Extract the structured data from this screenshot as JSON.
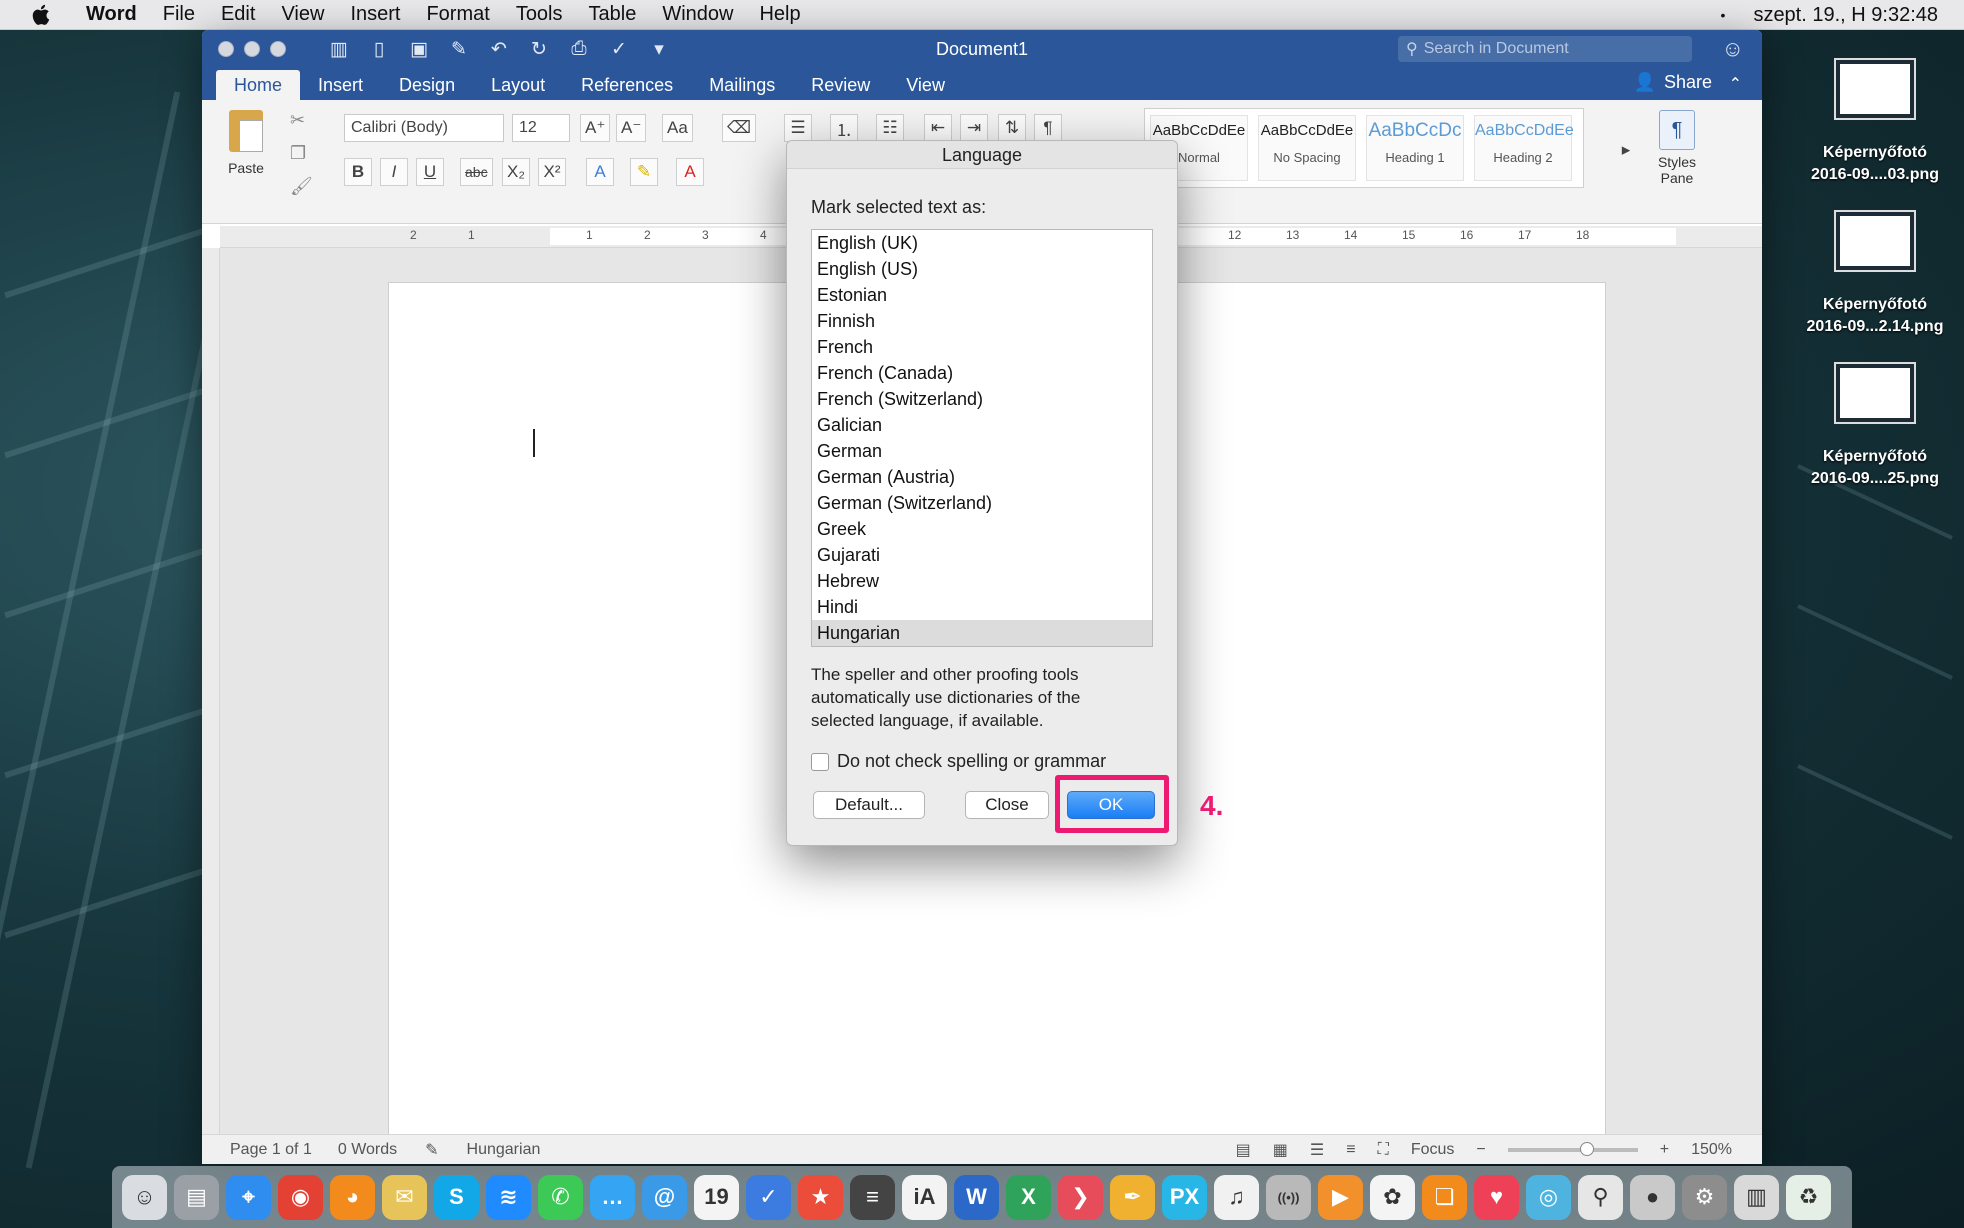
{
  "menubar": {
    "app_name": "Word",
    "items": [
      "File",
      "Edit",
      "View",
      "Insert",
      "Format",
      "Tools",
      "Table",
      "Window",
      "Help"
    ],
    "status_dot": "•",
    "clock": "szept. 19., H  9:32:48"
  },
  "window": {
    "title": "Document1",
    "search_placeholder": "Search in Document",
    "tabs": [
      "Home",
      "Insert",
      "Design",
      "Layout",
      "References",
      "Mailings",
      "Review",
      "View"
    ],
    "active_tab": "Home",
    "share_label": "Share"
  },
  "ribbon": {
    "paste_label": "Paste",
    "font_name": "Calibri (Body)",
    "font_size": "12",
    "styles": [
      {
        "preview": "AaBbCcDdEe",
        "name": "Normal"
      },
      {
        "preview": "AaBbCcDdEe",
        "name": "No Spacing"
      },
      {
        "preview": "AaBbCcDc",
        "name": "Heading 1"
      },
      {
        "preview": "AaBbCcDdEe",
        "name": "Heading 2"
      }
    ],
    "styles_pane_label": "Styles Pane"
  },
  "ruler": {
    "ticks": [
      "2",
      "1",
      "1",
      "2",
      "3",
      "4",
      "12",
      "13",
      "14",
      "15",
      "16",
      "17",
      "18"
    ]
  },
  "statusbar": {
    "page": "Page 1 of 1",
    "words": "0 Words",
    "language": "Hungarian",
    "focus": "Focus",
    "zoom": "150%"
  },
  "dialog": {
    "title": "Language",
    "prompt": "Mark selected text as:",
    "languages": [
      "English (UK)",
      "English (US)",
      "Estonian",
      "Finnish",
      "French",
      "French (Canada)",
      "French (Switzerland)",
      "Galician",
      "German",
      "German (Austria)",
      "German (Switzerland)",
      "Greek",
      "Gujarati",
      "Hebrew",
      "Hindi",
      "Hungarian"
    ],
    "selected": "Hungarian",
    "info": "The speller and other proofing tools automatically use dictionaries of the selected language, if available.",
    "checkbox_label": "Do not check spelling or grammar",
    "default_button": "Default...",
    "close_button": "Close",
    "ok_button": "OK"
  },
  "annotation": {
    "step": "4.",
    "color": "#ec1a70"
  },
  "desktop": {
    "icons": [
      {
        "line1": "Képernyőfotó",
        "line2": "2016-09....03.png"
      },
      {
        "line1": "Képernyőfotó",
        "line2": "2016-09...2.14.png"
      },
      {
        "line1": "Képernyőfotó",
        "line2": "2016-09....25.png"
      }
    ]
  },
  "dock": {
    "apps": [
      {
        "name": "finder",
        "glyph": "☺",
        "color": "#d9dde2"
      },
      {
        "name": "drive",
        "glyph": "▤",
        "color": "#9aa0a6"
      },
      {
        "name": "safari",
        "glyph": "⌖",
        "color": "#2f8df0"
      },
      {
        "name": "chrome",
        "glyph": "◉",
        "color": "#e34133"
      },
      {
        "name": "firefox",
        "glyph": "◕",
        "color": "#f28a1c"
      },
      {
        "name": "mail-stamp",
        "glyph": "✉",
        "color": "#e7c45a"
      },
      {
        "name": "skype",
        "glyph": "S",
        "color": "#12a8e8"
      },
      {
        "name": "messenger",
        "glyph": "≋",
        "color": "#1f8bff"
      },
      {
        "name": "phone",
        "glyph": "✆",
        "color": "#3cc956"
      },
      {
        "name": "messages",
        "glyph": "…",
        "color": "#35a4f2"
      },
      {
        "name": "mail-at",
        "glyph": "@",
        "color": "#3a9ae8"
      },
      {
        "name": "calendar",
        "glyph": "19",
        "color": "#f4f4f4"
      },
      {
        "name": "reminders",
        "glyph": "✓",
        "color": "#3c7be0"
      },
      {
        "name": "favorites",
        "glyph": "★",
        "color": "#ec4d3b"
      },
      {
        "name": "notes",
        "glyph": "≡",
        "color": "#444444"
      },
      {
        "name": "ia-writer",
        "glyph": "iA",
        "color": "#f3f3f3"
      },
      {
        "name": "word",
        "glyph": "W",
        "color": "#2b68c8"
      },
      {
        "name": "excel",
        "glyph": "X",
        "color": "#2fa35a"
      },
      {
        "name": "speed",
        "glyph": "❯",
        "color": "#e74c5a"
      },
      {
        "name": "pen",
        "glyph": "✒",
        "color": "#f0b030"
      },
      {
        "name": "pixelmator",
        "glyph": "PX",
        "color": "#28b6e6"
      },
      {
        "name": "music",
        "glyph": "♫",
        "color": "#f1f1f1"
      },
      {
        "name": "podcast",
        "glyph": "((•))",
        "color": "#b9b9b9"
      },
      {
        "name": "play",
        "glyph": "▶",
        "color": "#f2902b"
      },
      {
        "name": "photos",
        "glyph": "✿",
        "color": "#f4f4f4"
      },
      {
        "name": "books",
        "glyph": "❏",
        "color": "#f28a1c"
      },
      {
        "name": "pocket",
        "glyph": "♥",
        "color": "#ee4056"
      },
      {
        "name": "aperture",
        "glyph": "◎",
        "color": "#4fb3e0"
      },
      {
        "name": "spotlight",
        "glyph": "⚲",
        "color": "#e6e6e6"
      },
      {
        "name": "apple-store",
        "glyph": "●",
        "color": "#c9c9c9"
      },
      {
        "name": "system-prefs",
        "glyph": "⚙",
        "color": "#8d8d8d"
      },
      {
        "name": "documents",
        "glyph": "▥",
        "color": "#d9d9d9"
      },
      {
        "name": "trash",
        "glyph": "♻",
        "color": "#e6efe6"
      }
    ]
  }
}
